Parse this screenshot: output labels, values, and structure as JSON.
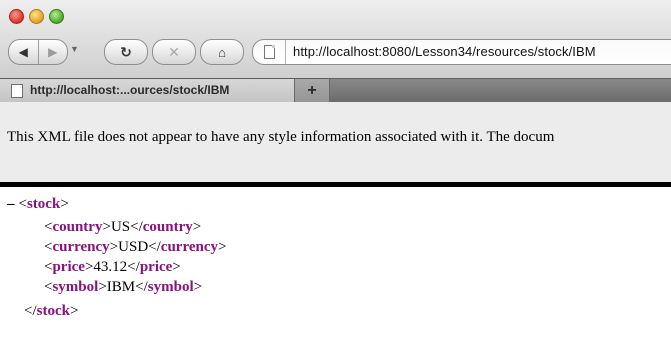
{
  "toolbar": {
    "back_icon": "back-arrow-icon",
    "forward_icon": "forward-arrow-icon",
    "reload_icon": "reload-icon",
    "stop_icon": "stop-icon",
    "home_icon": "home-icon",
    "url": "http://localhost:8080/Lesson34/resources/stock/IBM"
  },
  "tabs": [
    {
      "label": "http://localhost:...ources/stock/IBM"
    }
  ],
  "notice": {
    "text": "This XML file does not appear to have any style information associated with it. The docum"
  },
  "xml": {
    "collapse_marker": "–",
    "root_tag": "stock",
    "children": [
      {
        "tag": "country",
        "value": "US"
      },
      {
        "tag": "currency",
        "value": "USD"
      },
      {
        "tag": "price",
        "value": "43.12"
      },
      {
        "tag": "symbol",
        "value": "IBM"
      }
    ]
  }
}
